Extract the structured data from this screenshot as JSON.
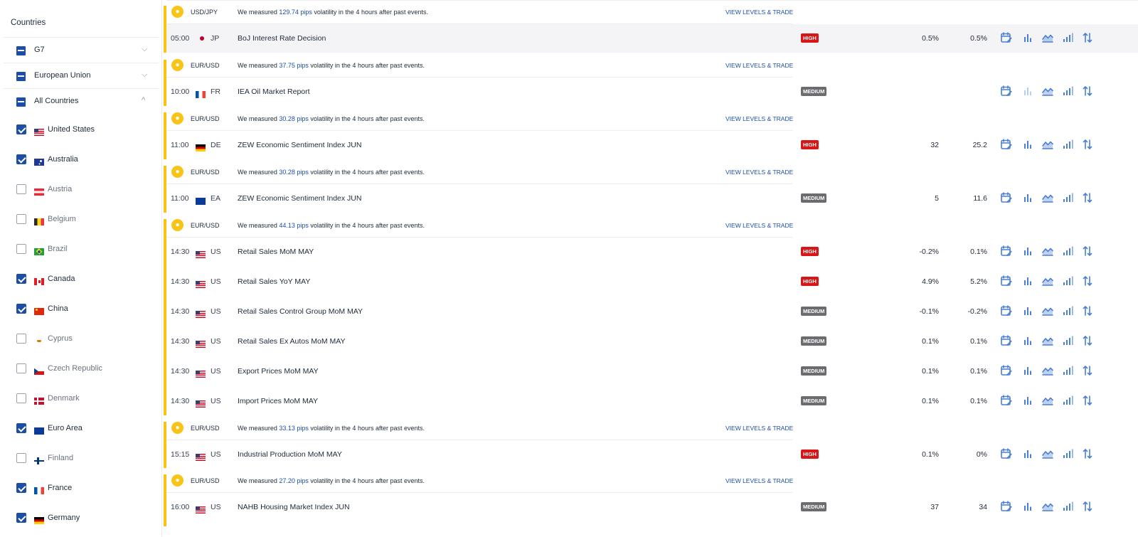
{
  "sidebar": {
    "title": "Countries",
    "groups": [
      {
        "label": "G7",
        "chevron": "⌵"
      },
      {
        "label": "European Union",
        "chevron": "⌵"
      },
      {
        "label": "All Countries",
        "chevron": "^"
      }
    ],
    "countries": [
      {
        "label": "United States",
        "checked": true,
        "flag": "us"
      },
      {
        "label": "Australia",
        "checked": true,
        "flag": "au"
      },
      {
        "label": "Austria",
        "checked": false,
        "flag": "at"
      },
      {
        "label": "Belgium",
        "checked": false,
        "flag": "be"
      },
      {
        "label": "Brazil",
        "checked": false,
        "flag": "br"
      },
      {
        "label": "Canada",
        "checked": true,
        "flag": "ca"
      },
      {
        "label": "China",
        "checked": true,
        "flag": "cn"
      },
      {
        "label": "Cyprus",
        "checked": false,
        "flag": "cy"
      },
      {
        "label": "Czech Republic",
        "checked": false,
        "flag": "cz"
      },
      {
        "label": "Denmark",
        "checked": false,
        "flag": "dk"
      },
      {
        "label": "Euro Area",
        "checked": true,
        "flag": "eu"
      },
      {
        "label": "Finland",
        "checked": false,
        "flag": "fi"
      },
      {
        "label": "France",
        "checked": true,
        "flag": "fr"
      },
      {
        "label": "Germany",
        "checked": true,
        "flag": "de"
      }
    ]
  },
  "volatility": [
    {
      "pair": "USD/JPY",
      "prefix": "We measured ",
      "pips": "129.74 pips",
      "suffix": " volatility in the 4 hours after past events.",
      "link": "VIEW LEVELS & TRADE"
    },
    {
      "pair": "EUR/USD",
      "prefix": "We measured ",
      "pips": "37.75 pips",
      "suffix": " volatility in the 4 hours after past events.",
      "link": "VIEW LEVELS & TRADE"
    },
    {
      "pair": "EUR/USD",
      "prefix": "We measured ",
      "pips": "30.28 pips",
      "suffix": " volatility in the 4 hours after past events.",
      "link": "VIEW LEVELS & TRADE"
    },
    {
      "pair": "EUR/USD",
      "prefix": "We measured ",
      "pips": "30.28 pips",
      "suffix": " volatility in the 4 hours after past events.",
      "link": "VIEW LEVELS & TRADE"
    },
    {
      "pair": "EUR/USD",
      "prefix": "We measured ",
      "pips": "44.13 pips",
      "suffix": " volatility in the 4 hours after past events.",
      "link": "VIEW LEVELS & TRADE"
    },
    {
      "pair": "EUR/USD",
      "prefix": "We measured ",
      "pips": "33.13 pips",
      "suffix": " volatility in the 4 hours after past events.",
      "link": "VIEW LEVELS & TRADE"
    },
    {
      "pair": "EUR/USD",
      "prefix": "We measured ",
      "pips": "27.20 pips",
      "suffix": " volatility in the 4 hours after past events.",
      "link": "VIEW LEVELS & TRADE"
    }
  ],
  "events": [
    {
      "time": "05:00",
      "country": "JP",
      "flag": "jp",
      "name": "BoJ Interest Rate Decision",
      "impact": "HIGH",
      "impact_level": "high",
      "actual": "0.5%",
      "forecast": "0.5%",
      "icon_colors": [
        "#4a7fd4",
        "#4a7fd4",
        "#4a7fd4",
        "#4a7fd4",
        "#4a7fd4"
      ]
    },
    {
      "time": "10:00",
      "country": "FR",
      "flag": "fr",
      "name": "IEA Oil Market Report",
      "impact": "MEDIUM",
      "impact_level": "medium",
      "actual": "",
      "forecast": "",
      "icon_colors": [
        "#4a7fd4",
        "#b9cdf0",
        "#4a7fd4",
        "#4a7fd4",
        "#4a7fd4"
      ]
    },
    {
      "time": "11:00",
      "country": "DE",
      "flag": "de",
      "name": "ZEW Economic Sentiment Index JUN",
      "impact": "HIGH",
      "impact_level": "high",
      "actual": "32",
      "forecast": "25.2",
      "icon_colors": [
        "#4a7fd4",
        "#4a7fd4",
        "#4a7fd4",
        "#4a7fd4",
        "#4a7fd4"
      ]
    },
    {
      "time": "11:00",
      "country": "EA",
      "flag": "ea",
      "name": "ZEW Economic Sentiment Index JUN",
      "impact": "MEDIUM",
      "impact_level": "medium",
      "actual": "5",
      "forecast": "11.6",
      "icon_colors": [
        "#4a7fd4",
        "#4a7fd4",
        "#4a7fd4",
        "#4a7fd4",
        "#4a7fd4"
      ]
    },
    {
      "time": "14:30",
      "country": "US",
      "flag": "us",
      "name": "Retail Sales MoM MAY",
      "impact": "HIGH",
      "impact_level": "high",
      "actual": "-0.2%",
      "forecast": "0.1%",
      "icon_colors": [
        "#4a7fd4",
        "#4a7fd4",
        "#4a7fd4",
        "#4a7fd4",
        "#4a7fd4"
      ]
    },
    {
      "time": "14:30",
      "country": "US",
      "flag": "us",
      "name": "Retail Sales YoY MAY",
      "impact": "HIGH",
      "impact_level": "high",
      "actual": "4.9%",
      "forecast": "5.2%",
      "icon_colors": [
        "#4a7fd4",
        "#4a7fd4",
        "#4a7fd4",
        "#4a7fd4",
        "#4a7fd4"
      ]
    },
    {
      "time": "14:30",
      "country": "US",
      "flag": "us",
      "name": "Retail Sales Control Group MoM MAY",
      "impact": "MEDIUM",
      "impact_level": "medium",
      "actual": "-0.1%",
      "forecast": "-0.2%",
      "icon_colors": [
        "#4a7fd4",
        "#4a7fd4",
        "#4a7fd4",
        "#4a7fd4",
        "#4a7fd4"
      ]
    },
    {
      "time": "14:30",
      "country": "US",
      "flag": "us",
      "name": "Retail Sales Ex Autos MoM MAY",
      "impact": "MEDIUM",
      "impact_level": "medium",
      "actual": "0.1%",
      "forecast": "0.1%",
      "icon_colors": [
        "#4a7fd4",
        "#4a7fd4",
        "#4a7fd4",
        "#4a7fd4",
        "#4a7fd4"
      ]
    },
    {
      "time": "14:30",
      "country": "US",
      "flag": "us",
      "name": "Export Prices MoM MAY",
      "impact": "MEDIUM",
      "impact_level": "medium",
      "actual": "0.1%",
      "forecast": "0.1%",
      "icon_colors": [
        "#4a7fd4",
        "#4a7fd4",
        "#4a7fd4",
        "#4a7fd4",
        "#4a7fd4"
      ]
    },
    {
      "time": "14:30",
      "country": "US",
      "flag": "us",
      "name": "Import Prices MoM MAY",
      "impact": "MEDIUM",
      "impact_level": "medium",
      "actual": "0.1%",
      "forecast": "0.1%",
      "icon_colors": [
        "#4a7fd4",
        "#4a7fd4",
        "#4a7fd4",
        "#4a7fd4",
        "#4a7fd4"
      ]
    },
    {
      "time": "15:15",
      "country": "US",
      "flag": "us",
      "name": "Industrial Production MoM MAY",
      "impact": "HIGH",
      "impact_level": "high",
      "actual": "0.1%",
      "forecast": "0%",
      "icon_colors": [
        "#4a7fd4",
        "#4a7fd4",
        "#4a7fd4",
        "#4a7fd4",
        "#4a7fd4"
      ]
    },
    {
      "time": "16:00",
      "country": "US",
      "flag": "us",
      "name": "NAHB Housing Market Index JUN",
      "impact": "MEDIUM",
      "impact_level": "medium",
      "actual": "37",
      "forecast": "34",
      "icon_colors": [
        "#4a7fd4",
        "#4a7fd4",
        "#4a7fd4",
        "#4a7fd4",
        "#4a7fd4"
      ]
    }
  ],
  "row_icons": [
    "calendar-edit-icon",
    "bar-chart-icon",
    "trend-chart-icon",
    "signal-bars-icon",
    "sort-arrows-icon"
  ],
  "colors": {
    "accent_yellow": "#f7c417",
    "link_blue": "#1c4ea8",
    "icon_blue": "#4a7fd4",
    "high_red": "#d91616",
    "medium_gray": "#6b6b70"
  }
}
